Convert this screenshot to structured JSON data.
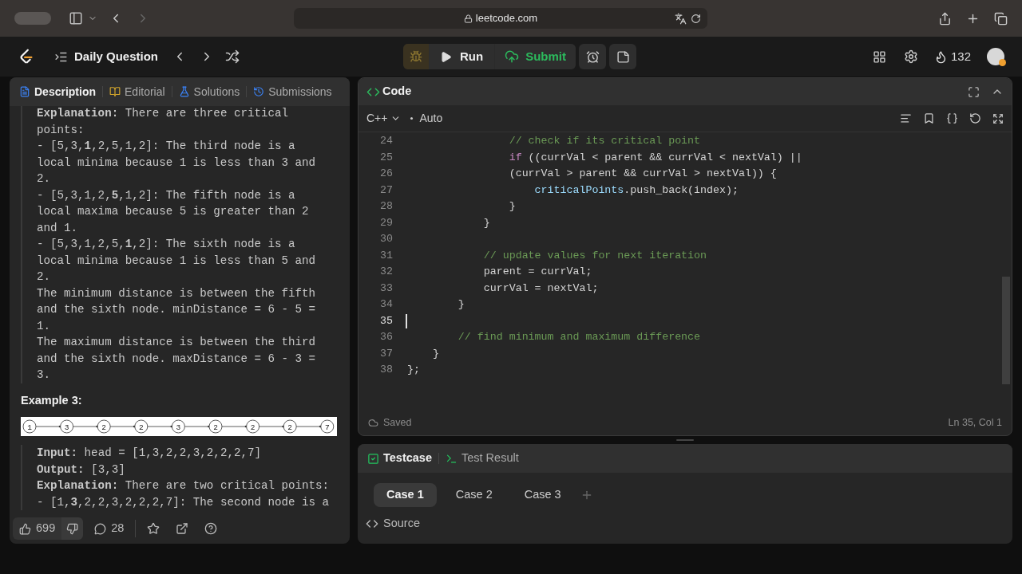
{
  "browser": {
    "url": "leetcode.com"
  },
  "topbar": {
    "title": "Daily Question",
    "run": "Run",
    "submit": "Submit",
    "streak": "132"
  },
  "left_tabs": [
    {
      "label": "Description",
      "selected": true
    },
    {
      "label": "Editorial",
      "selected": false
    },
    {
      "label": "Solutions",
      "selected": false
    },
    {
      "label": "Submissions",
      "selected": false
    }
  ],
  "description": {
    "lines": [
      "**Explanation:** There are three critical",
      "points:",
      "- [5,3,**1**,2,5,1,2]: The third node is a",
      "local minima because 1 is less than 3 and",
      "2.",
      "- [5,3,1,2,**5**,1,2]: The fifth node is a",
      "local maxima because 5 is greater than 2",
      "and 1.",
      "- [5,3,1,2,5,**1**,2]: The sixth node is a",
      "local minima because 1 is less than 5 and",
      "2.",
      "The minimum distance is between the fifth",
      "and the sixth node. minDistance = 6 - 5 =",
      "1.",
      "The maximum distance is between the third",
      "and the sixth node. maxDistance = 6 - 3 =",
      "3."
    ],
    "example_heading": "Example 3:",
    "list_nodes": [
      "1",
      "3",
      "2",
      "2",
      "3",
      "2",
      "2",
      "2",
      "7"
    ],
    "example_lines": [
      "**Input:** head = [1,3,2,2,3,2,2,2,7]",
      "**Output:** [3,3]",
      "**Explanation:** There are two critical points:",
      "- [1,**3**,2,2,3,2,2,2,7]: The second node is a"
    ]
  },
  "footer": {
    "likes": "699",
    "comments": "28"
  },
  "editor": {
    "title": "Code",
    "language": "C++",
    "mode": "Auto",
    "status": "Saved",
    "position": "Ln 35, Col 1",
    "lines": [
      {
        "number": "24",
        "cursor": false,
        "tokens": [
          {
            "kind": "comment",
            "text": "                // check if its critical point"
          }
        ]
      },
      {
        "number": "25",
        "cursor": false,
        "tokens": [
          {
            "kind": "keyword",
            "text": "                if"
          },
          {
            "kind": "plain",
            "text": " ((currVal < parent && currVal < nextVal) ||"
          }
        ]
      },
      {
        "number": "26",
        "cursor": false,
        "tokens": [
          {
            "kind": "plain",
            "text": "                (currVal > parent && currVal > nextVal)) {"
          }
        ]
      },
      {
        "number": "27",
        "cursor": false,
        "tokens": [
          {
            "kind": "var",
            "text": "                    criticalPoints"
          },
          {
            "kind": "plain",
            "text": ".push_back(index);"
          }
        ]
      },
      {
        "number": "28",
        "cursor": false,
        "tokens": [
          {
            "kind": "plain",
            "text": "                }"
          }
        ]
      },
      {
        "number": "29",
        "cursor": false,
        "tokens": [
          {
            "kind": "plain",
            "text": "            }"
          }
        ]
      },
      {
        "number": "30",
        "cursor": false
      },
      {
        "number": "31",
        "cursor": false,
        "tokens": [
          {
            "kind": "comment",
            "text": "            // update values for next iteration"
          }
        ]
      },
      {
        "number": "32",
        "cursor": false,
        "tokens": [
          {
            "kind": "plain",
            "text": "            parent = currVal;"
          }
        ]
      },
      {
        "number": "33",
        "cursor": false,
        "tokens": [
          {
            "kind": "plain",
            "text": "            currVal = nextVal;"
          }
        ]
      },
      {
        "number": "34",
        "cursor": false,
        "tokens": [
          {
            "kind": "plain",
            "text": "        }"
          }
        ]
      },
      {
        "number": "35",
        "cursor": true
      },
      {
        "number": "36",
        "cursor": false,
        "tokens": [
          {
            "kind": "comment",
            "text": "        // find minimum and maximum difference"
          }
        ]
      },
      {
        "number": "37",
        "cursor": false,
        "tokens": [
          {
            "kind": "plain",
            "text": "    }"
          }
        ]
      },
      {
        "number": "38",
        "cursor": false,
        "tokens": [
          {
            "kind": "plain",
            "text": "};"
          }
        ]
      }
    ]
  },
  "testcase": {
    "tabs": [
      {
        "label": "Testcase",
        "selected": true
      },
      {
        "label": "Test Result",
        "selected": false
      }
    ],
    "cases": [
      {
        "label": "Case 1",
        "selected": true
      },
      {
        "label": "Case 2",
        "selected": false
      },
      {
        "label": "Case 3",
        "selected": false
      }
    ],
    "source": "Source"
  }
}
